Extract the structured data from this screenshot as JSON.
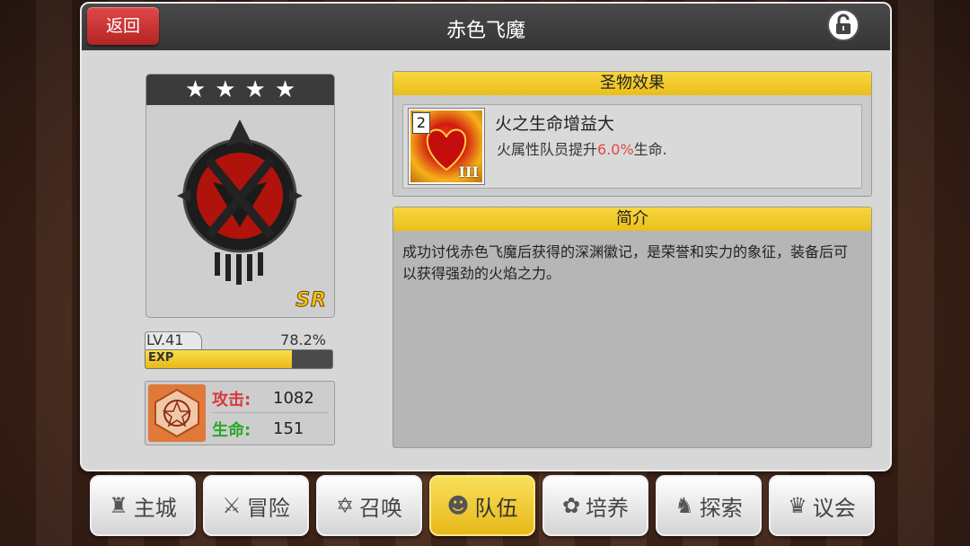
{
  "header": {
    "back_label": "返回",
    "title": "赤色飞魔",
    "lock_icon": "unlock-icon"
  },
  "relic": {
    "stars": 4,
    "rarity": "SR",
    "level_label": "LV.41",
    "exp_percent_label": "78.2%",
    "exp_fraction": 0.782,
    "exp_label": "EXP"
  },
  "stats": {
    "attack_label": "攻击:",
    "attack_value": "1082",
    "hp_label": "生命:",
    "hp_value": "151",
    "attack_color": "#d83a3a",
    "hp_color": "#2aa82a"
  },
  "effect": {
    "header": "圣物效果",
    "skill_level": "2",
    "skill_rank": "III",
    "skill_name": "火之生命增益大",
    "desc_pre": "火属性队员提升",
    "desc_value": "6.0%",
    "desc_post": "生命."
  },
  "intro": {
    "header": "简介",
    "text": "成功讨伐赤色飞魔后获得的深渊徽记，是荣誉和实力的象征，装备后可以获得强劲的火焰之力。"
  },
  "nav": [
    {
      "label": "主城",
      "icon": "castle-icon",
      "glyph": "♜",
      "active": false
    },
    {
      "label": "冒险",
      "icon": "crossed-swords-icon",
      "glyph": "⚔",
      "active": false
    },
    {
      "label": "召唤",
      "icon": "pentagram-icon",
      "glyph": "✡",
      "active": false
    },
    {
      "label": "队伍",
      "icon": "team-icon",
      "glyph": "☻",
      "active": true
    },
    {
      "label": "培养",
      "icon": "nurture-icon",
      "glyph": "✿",
      "active": false
    },
    {
      "label": "探索",
      "icon": "explore-icon",
      "glyph": "♞",
      "active": false
    },
    {
      "label": "议会",
      "icon": "council-icon",
      "glyph": "♛",
      "active": false
    }
  ]
}
